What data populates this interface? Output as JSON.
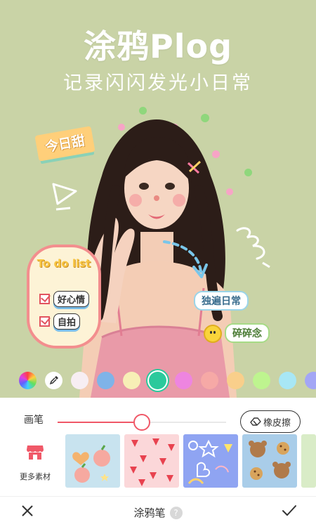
{
  "hero": {
    "title": "涂鸦Plog",
    "subtitle": "记录闪闪发光小日常",
    "background": "#c9d3a6"
  },
  "stickers": {
    "tag": "今日甜",
    "todo_title": "To do list",
    "todo_items": [
      "好心情",
      "自拍"
    ],
    "pill_1": "独遍日常",
    "pill_2": "碎碎念"
  },
  "palette": {
    "colors": [
      "rainbow",
      "picker",
      "#f7eef3",
      "#7fb3e8",
      "#f7efb6",
      "#2bc99c",
      "#ee85e0",
      "#f6a9a6",
      "#f9cf8b",
      "#bef48f",
      "#a8e7f5",
      "#a3a6f5"
    ],
    "selected_index": 5
  },
  "panel": {
    "brush_label": "画笔",
    "brush_size_fraction": 0.5,
    "eraser_label": "橡皮擦",
    "more_materials_label": "更多素材",
    "thumbnails": [
      "peach-sticker-pack",
      "strawberry-pattern-pack",
      "doodle-icons-pack",
      "teddy-bear-pack",
      "partial-pack"
    ]
  },
  "bottom_bar": {
    "title": "涂鸦笔",
    "help": "?",
    "accent": "#f05868"
  }
}
